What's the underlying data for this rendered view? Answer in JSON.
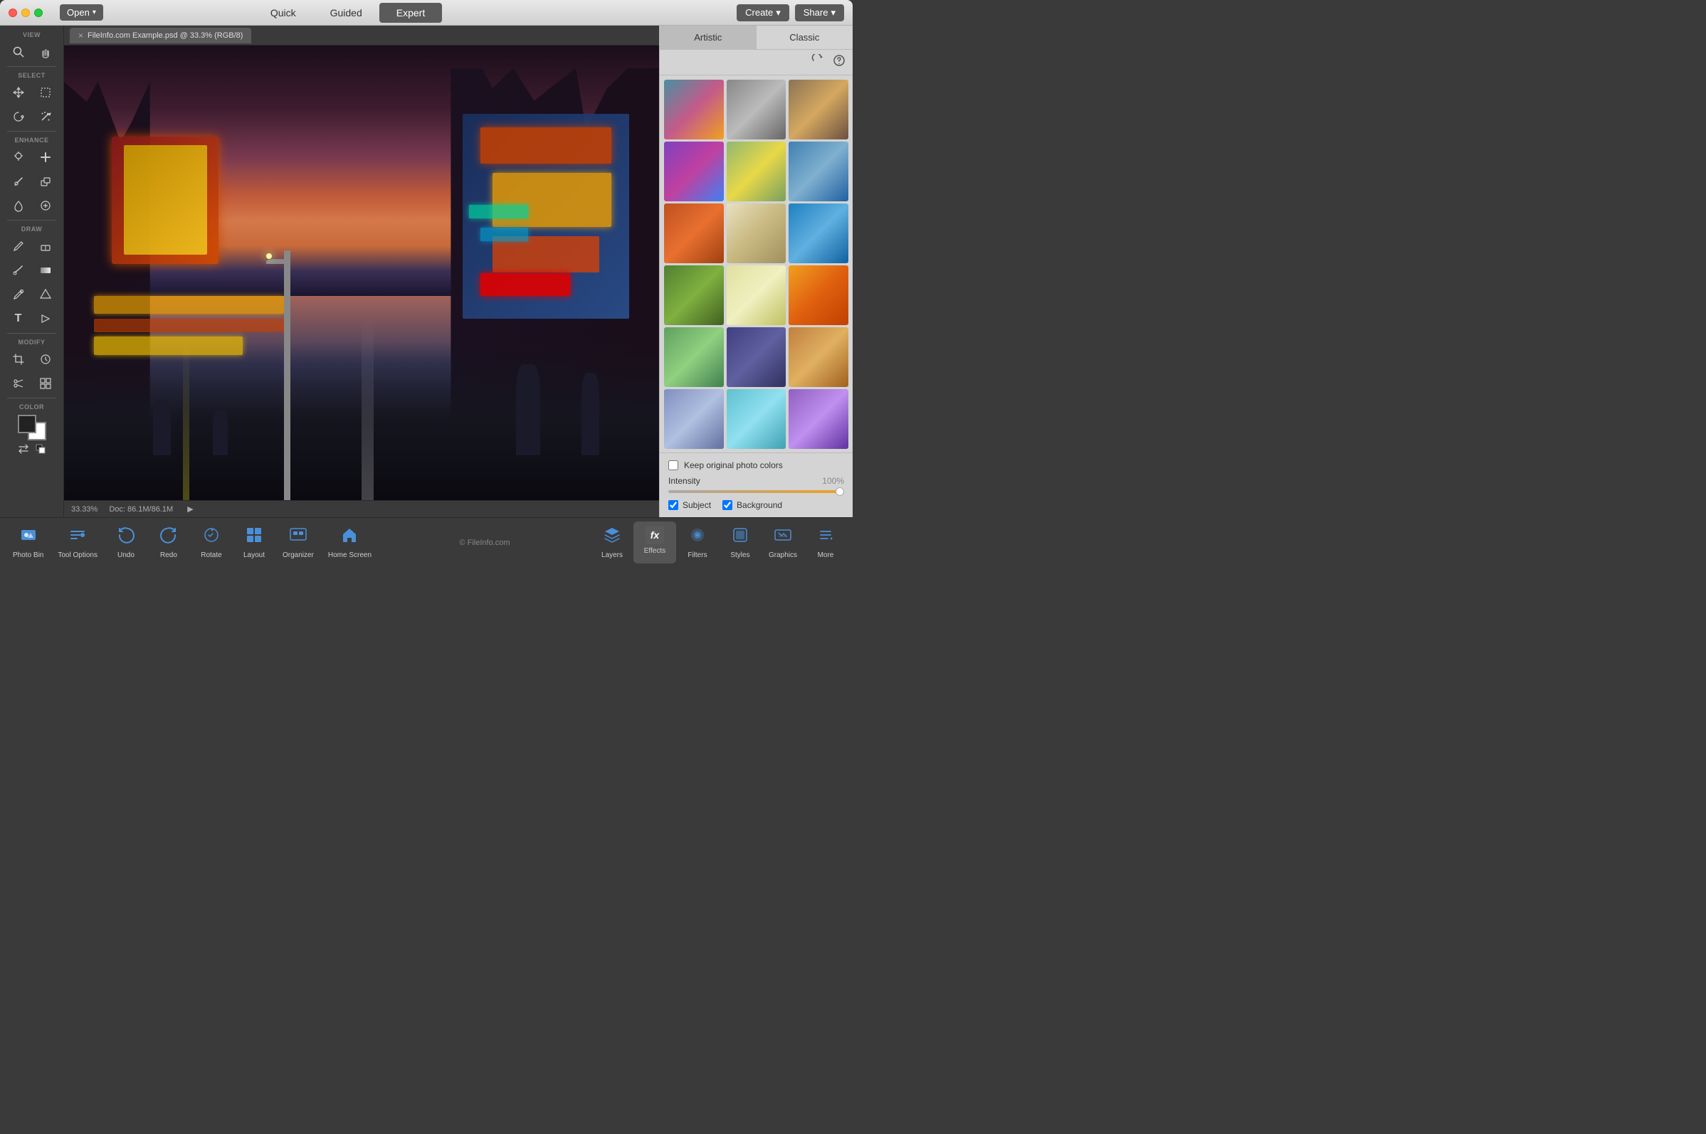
{
  "titlebar": {
    "open_label": "Open",
    "nav_tabs": [
      {
        "id": "quick",
        "label": "Quick",
        "active": false
      },
      {
        "id": "guided",
        "label": "Guided",
        "active": false
      },
      {
        "id": "expert",
        "label": "Expert",
        "active": true
      }
    ],
    "create_label": "Create",
    "share_label": "Share"
  },
  "file_tab": {
    "close_symbol": "×",
    "title": "FileInfo.com Example.psd @ 33.3% (RGB/8)"
  },
  "toolbar": {
    "sections": [
      {
        "label": "VIEW",
        "tools": [
          {
            "id": "zoom",
            "icon": "🔍",
            "active": false
          },
          {
            "id": "hand",
            "icon": "✋",
            "active": false
          }
        ]
      },
      {
        "label": "SELECT",
        "tools": [
          {
            "id": "move",
            "icon": "✛",
            "active": false
          },
          {
            "id": "marquee",
            "icon": "⬜",
            "active": false
          },
          {
            "id": "lasso",
            "icon": "⊙",
            "active": false
          },
          {
            "id": "magic-wand",
            "icon": "✦",
            "active": false
          }
        ]
      },
      {
        "label": "ENHANCE",
        "tools": [
          {
            "id": "eyedropper",
            "icon": "＋",
            "active": false
          },
          {
            "id": "heal",
            "icon": "✚",
            "active": false
          },
          {
            "id": "brush",
            "icon": "/",
            "active": false
          },
          {
            "id": "stamp",
            "icon": "⊟",
            "active": false
          },
          {
            "id": "water",
            "icon": "💧",
            "active": false
          },
          {
            "id": "brain",
            "icon": "⬡",
            "active": false
          }
        ]
      },
      {
        "label": "DRAW",
        "tools": [
          {
            "id": "pencil",
            "icon": "✏",
            "active": false
          },
          {
            "id": "eraser",
            "icon": "◻",
            "active": false
          },
          {
            "id": "smudge",
            "icon": "∿",
            "active": false
          },
          {
            "id": "gradient",
            "icon": "▭",
            "active": false
          },
          {
            "id": "eyedropper2",
            "icon": "╱",
            "active": false
          },
          {
            "id": "sparkle",
            "icon": "✳",
            "active": false
          },
          {
            "id": "text",
            "icon": "T",
            "active": false
          },
          {
            "id": "color-pencil",
            "icon": "🖊",
            "active": false
          }
        ]
      },
      {
        "label": "MODIFY",
        "tools": [
          {
            "id": "crop",
            "icon": "⊞",
            "active": false
          },
          {
            "id": "recompose",
            "icon": "⚙",
            "active": false
          },
          {
            "id": "scissors",
            "icon": "✂",
            "active": false
          },
          {
            "id": "resize",
            "icon": "⊡",
            "active": false
          }
        ]
      },
      {
        "label": "COLOR",
        "fg_color": "#222222",
        "bg_color": "#ffffff"
      }
    ]
  },
  "status_bar": {
    "zoom": "33.33%",
    "doc_info": "Doc: 86.1M/86.1M"
  },
  "right_panel": {
    "tabs": [
      {
        "id": "artistic",
        "label": "Artistic",
        "active": true
      },
      {
        "id": "classic",
        "label": "Classic",
        "active": false
      }
    ],
    "effects": [
      {
        "id": 1,
        "class": "thumb-1"
      },
      {
        "id": 2,
        "class": "thumb-2"
      },
      {
        "id": 3,
        "class": "thumb-3"
      },
      {
        "id": 4,
        "class": "thumb-4"
      },
      {
        "id": 5,
        "class": "thumb-5"
      },
      {
        "id": 6,
        "class": "thumb-6"
      },
      {
        "id": 7,
        "class": "thumb-7"
      },
      {
        "id": 8,
        "class": "thumb-8"
      },
      {
        "id": 9,
        "class": "thumb-9"
      },
      {
        "id": 10,
        "class": "thumb-10"
      },
      {
        "id": 11,
        "class": "thumb-11"
      },
      {
        "id": 12,
        "class": "thumb-12"
      },
      {
        "id": 13,
        "class": "thumb-13"
      },
      {
        "id": 14,
        "class": "thumb-14"
      },
      {
        "id": 15,
        "class": "thumb-15"
      },
      {
        "id": 16,
        "class": "thumb-16"
      },
      {
        "id": 17,
        "class": "thumb-17"
      },
      {
        "id": 18,
        "class": "thumb-18"
      }
    ],
    "keep_original_label": "Keep original photo colors",
    "intensity_label": "Intensity",
    "intensity_value": "100%",
    "subject_label": "Subject",
    "background_label": "Background"
  },
  "bottom_toolbar": {
    "tools": [
      {
        "id": "photo-bin",
        "label": "Photo Bin",
        "icon": "photo"
      },
      {
        "id": "tool-options",
        "label": "Tool Options",
        "icon": "tool"
      },
      {
        "id": "undo",
        "label": "Undo",
        "icon": "undo"
      },
      {
        "id": "redo",
        "label": "Redo",
        "icon": "redo"
      },
      {
        "id": "rotate",
        "label": "Rotate",
        "icon": "rotate"
      },
      {
        "id": "layout",
        "label": "Layout",
        "icon": "layout"
      },
      {
        "id": "organizer",
        "label": "Organizer",
        "icon": "organizer"
      },
      {
        "id": "home-screen",
        "label": "Home Screen",
        "icon": "home"
      }
    ],
    "right_tools": [
      {
        "id": "layers",
        "label": "Layers",
        "icon": "layers"
      },
      {
        "id": "effects",
        "label": "Effects",
        "icon": "effects",
        "active": true
      },
      {
        "id": "filters",
        "label": "Filters",
        "icon": "filters"
      },
      {
        "id": "styles",
        "label": "Styles",
        "icon": "styles"
      },
      {
        "id": "graphics",
        "label": "Graphics",
        "icon": "graphics"
      },
      {
        "id": "more",
        "label": "More",
        "icon": "more"
      }
    ],
    "watermark": "© FileInfo.com"
  }
}
